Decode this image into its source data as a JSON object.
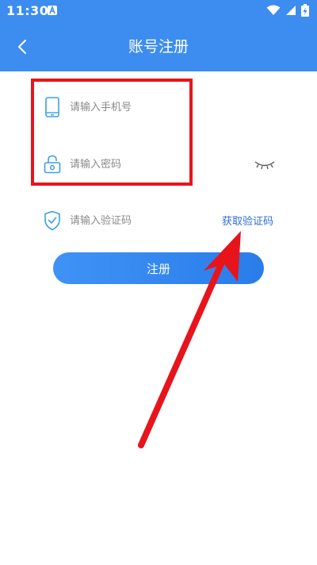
{
  "status_bar": {
    "time": "11:30",
    "notification_icon": "a-badge-icon",
    "wifi_icon": "wifi-icon",
    "signal_icon": "signal-icon",
    "battery_icon": "battery-charging-icon"
  },
  "header": {
    "title": "账号注册",
    "back_icon": "chevron-left-icon",
    "background_color": "#3d8cf0"
  },
  "form": {
    "phone": {
      "icon": "phone-icon",
      "placeholder": "请输入手机号",
      "value": ""
    },
    "password": {
      "icon": "lock-icon",
      "placeholder": "请输入密码",
      "value": "",
      "visibility_icon": "eye-closed-icon"
    },
    "verification_code": {
      "icon": "shield-check-icon",
      "placeholder": "请输入验证码",
      "value": "",
      "get_code_label": "获取验证码"
    },
    "register_label": "注册"
  },
  "colors": {
    "accent": "#3d8cf0",
    "link": "#2f6fd6",
    "annotation": "#e8141c",
    "icon": "#3aa0e8"
  }
}
